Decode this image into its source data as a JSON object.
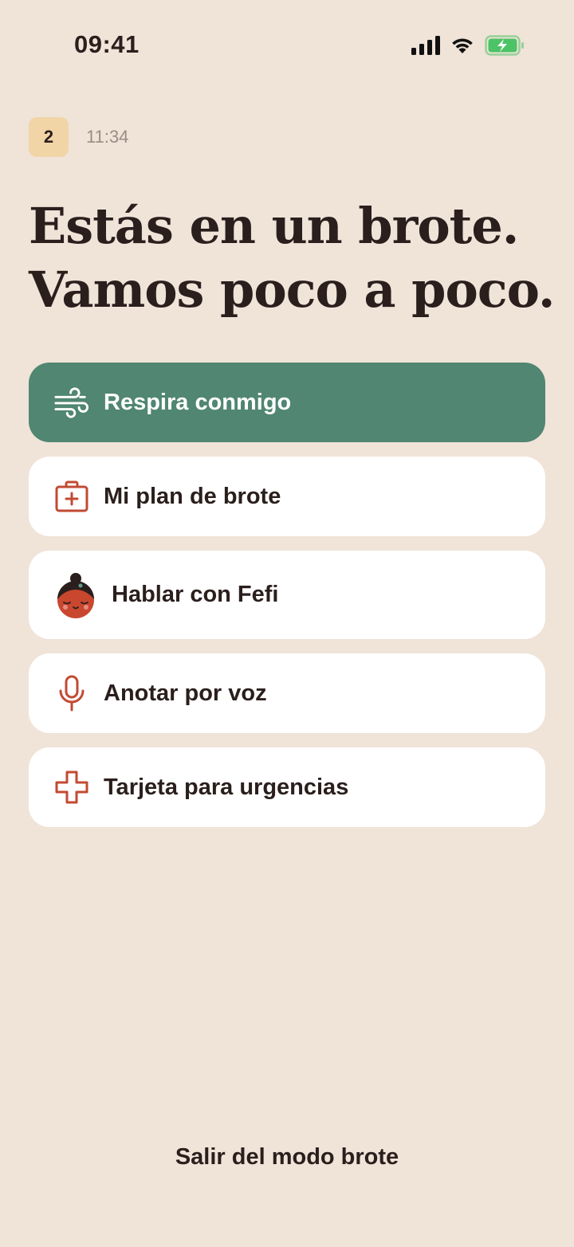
{
  "status_bar": {
    "time": "09:41",
    "icons": [
      "cellular-signal-icon",
      "wifi-icon",
      "battery-charging-icon"
    ]
  },
  "header": {
    "day_badge": "2",
    "time": "11:34"
  },
  "headline": {
    "line1": "Estás en un brote.",
    "line2": "Vamos poco a poco."
  },
  "actions": [
    {
      "label": "Respira conmigo",
      "icon": "wind-icon"
    },
    {
      "label": "Mi plan de brote",
      "icon": "first-aid-kit-icon"
    },
    {
      "label": "Hablar con Fefi",
      "icon": "fefi-avatar-icon"
    },
    {
      "label": "Anotar por voz",
      "icon": "microphone-icon"
    },
    {
      "label": "Tarjeta para urgencias",
      "icon": "medical-cross-icon"
    }
  ],
  "footer": {
    "exit_label": "Salir del modo brote"
  },
  "colors": {
    "background": "#F0E3D8",
    "primary": "#508672",
    "accent": "#C24A33",
    "badge": "#F1D5A6",
    "text": "#2A1F1D",
    "battery": "#4CC366"
  }
}
